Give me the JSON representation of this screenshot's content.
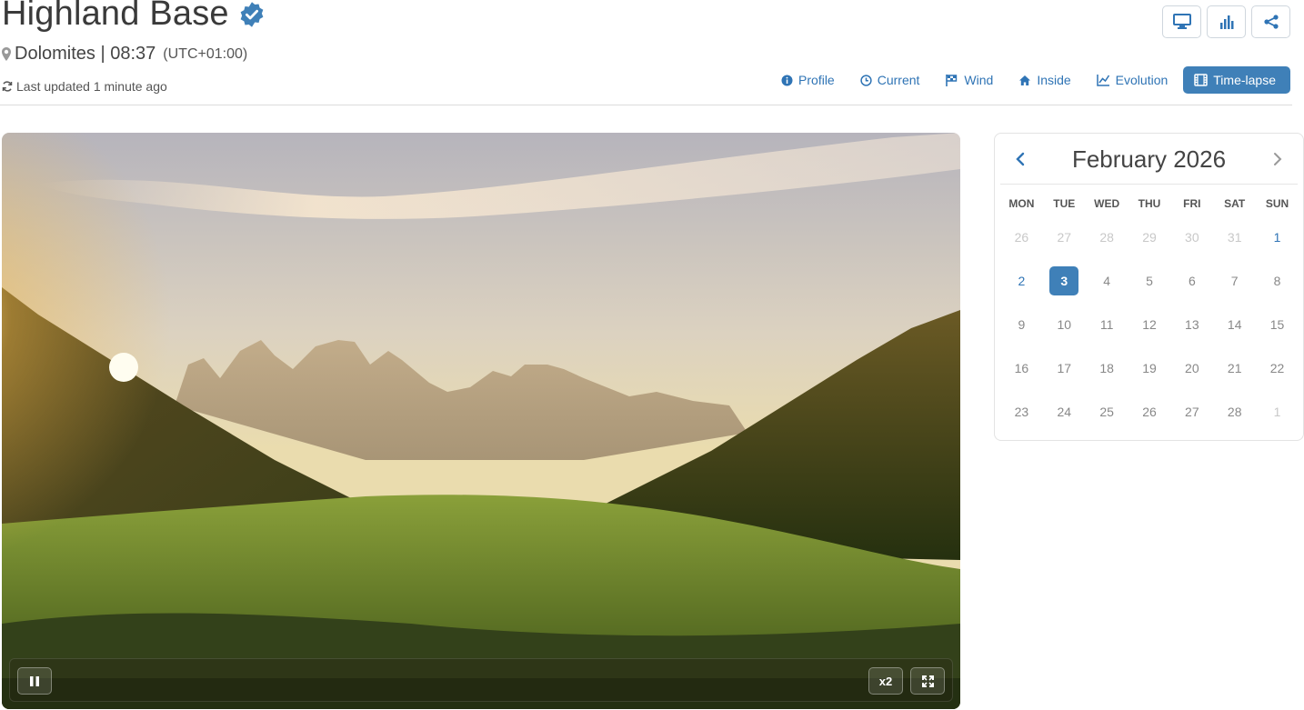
{
  "station": {
    "name": "Highland Base",
    "location": "Dolomites | 08:37",
    "timezone": "(UTC+01:00)",
    "last_updated": "Last updated 1 minute ago"
  },
  "toolbar": {
    "icons": [
      "monitor-icon",
      "bar-chart-icon",
      "share-icon"
    ]
  },
  "nav": {
    "items": [
      {
        "label": "Profile",
        "icon": "info-icon"
      },
      {
        "label": "Current",
        "icon": "clock-icon"
      },
      {
        "label": "Wind",
        "icon": "flag-icon"
      },
      {
        "label": "Inside",
        "icon": "home-icon"
      },
      {
        "label": "Evolution",
        "icon": "line-chart-icon"
      },
      {
        "label": "Time-lapse",
        "icon": "film-icon",
        "active": true
      }
    ]
  },
  "player": {
    "speed": "x2",
    "controls": [
      "pause-icon",
      "fullscreen-icon"
    ]
  },
  "calendar": {
    "title": "February 2026",
    "weekdays": [
      "MON",
      "TUE",
      "WED",
      "THU",
      "FRI",
      "SAT",
      "SUN"
    ],
    "weeks": [
      [
        "26",
        "27",
        "28",
        "29",
        "30",
        "31",
        "1"
      ],
      [
        "2",
        "3",
        "4",
        "5",
        "6",
        "7",
        "8"
      ],
      [
        "9",
        "10",
        "11",
        "12",
        "13",
        "14",
        "15"
      ],
      [
        "16",
        "17",
        "18",
        "19",
        "20",
        "21",
        "22"
      ],
      [
        "23",
        "24",
        "25",
        "26",
        "27",
        "28",
        "1"
      ]
    ],
    "selected": "3"
  },
  "colors": {
    "accent": "#3f80b8",
    "link": "#2f74b5"
  }
}
